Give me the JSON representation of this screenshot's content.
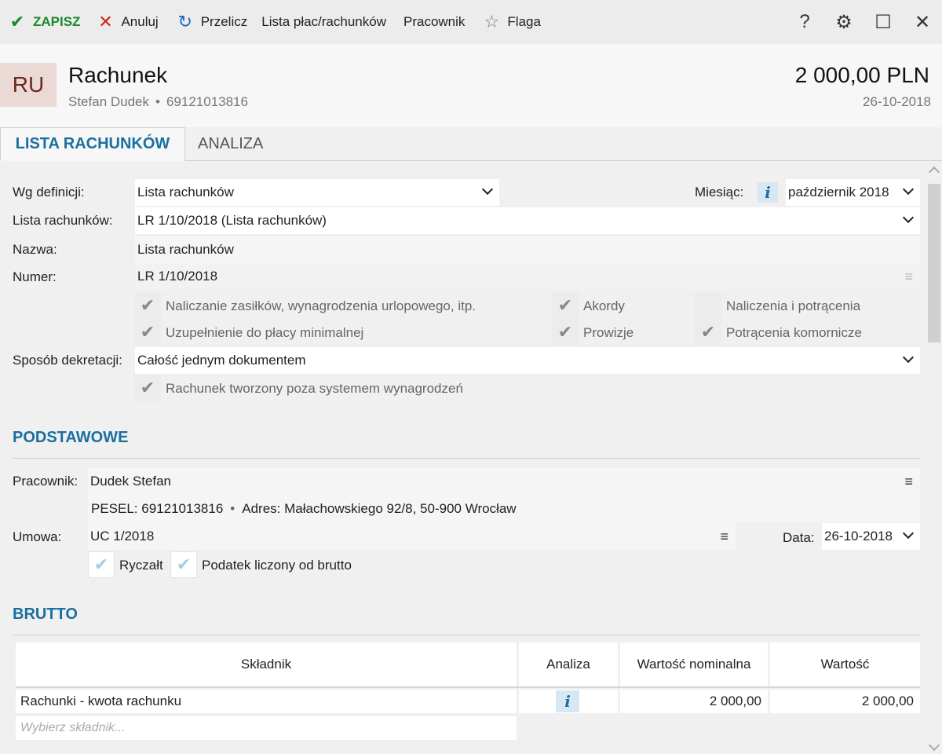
{
  "toolbar": {
    "save_label": "ZAPISZ",
    "cancel_label": "Anuluj",
    "recalc_label": "Przelicz",
    "list_label": "Lista płac/rachunków",
    "employee_label": "Pracownik",
    "flag_label": "Flaga"
  },
  "header": {
    "avatar": "RU",
    "title": "Rachunek",
    "employee_name": "Stefan Dudek",
    "pesel": "69121013816",
    "amount": "2 000,00 PLN",
    "date": "26-10-2018"
  },
  "tabs": [
    {
      "label": "LISTA RACHUNKÓW",
      "active": true
    },
    {
      "label": "ANALIZA",
      "active": false
    }
  ],
  "form": {
    "definition_label": "Wg definicji:",
    "definition_value": "Lista rachunków",
    "month_label": "Miesiąc:",
    "month_value": "październik 2018",
    "list_label": "Lista rachunków:",
    "list_value": "LR 1/10/2018 (Lista rachunków)",
    "name_label": "Nazwa:",
    "name_value": "Lista rachunków",
    "number_label": "Numer:",
    "number_value": "LR 1/10/2018",
    "checks": [
      {
        "label": "Naliczanie zasiłków, wynagrodzenia urlopowego, itp.",
        "checked": true
      },
      {
        "label": "Akordy",
        "checked": true
      },
      {
        "label": "Naliczenia i potrącenia",
        "checked": false
      },
      {
        "label": "Uzupełnienie do płacy minimalnej",
        "checked": true
      },
      {
        "label": "Prowizje",
        "checked": true
      },
      {
        "label": "Potrącenia komornicze",
        "checked": true
      }
    ],
    "decree_label": "Sposób dekretacji:",
    "decree_value": "Całość jednym dokumentem",
    "outside_label": "Rachunek tworzony poza systemem wynagrodzeń",
    "outside_checked": true
  },
  "podstawowe": {
    "title": "PODSTAWOWE",
    "employee_label": "Pracownik:",
    "employee_value": "Dudek Stefan",
    "pesel_label": "PESEL:",
    "pesel_value": "69121013816",
    "address_label": "Adres:",
    "address_value": "Małachowskiego 92/8, 50-900 Wrocław",
    "contract_label": "Umowa:",
    "contract_value": "UC 1/2018",
    "date_label": "Data:",
    "date_value": "26-10-2018",
    "lump_label": "Ryczałt",
    "lump_checked": true,
    "gross_tax_label": "Podatek liczony od brutto",
    "gross_tax_checked": true
  },
  "brutto": {
    "title": "BRUTTO",
    "columns": [
      "Składnik",
      "Analiza",
      "Wartość nominalna",
      "Wartość"
    ],
    "rows": [
      {
        "component": "Rachunki - kwota rachunku",
        "nominal": "2 000,00",
        "value": "2 000,00"
      }
    ],
    "new_placeholder": "Wybierz składnik..."
  },
  "icons": {
    "save": "check-icon",
    "cancel": "x-icon",
    "recalc": "refresh-icon",
    "flag": "star-icon",
    "help": "question-icon",
    "settings": "gear-icon",
    "maximize": "maximize-icon",
    "close": "close-icon"
  },
  "colors": {
    "accent": "#1a6fa0",
    "save": "#1b8a2b",
    "cancel": "#d32020"
  }
}
